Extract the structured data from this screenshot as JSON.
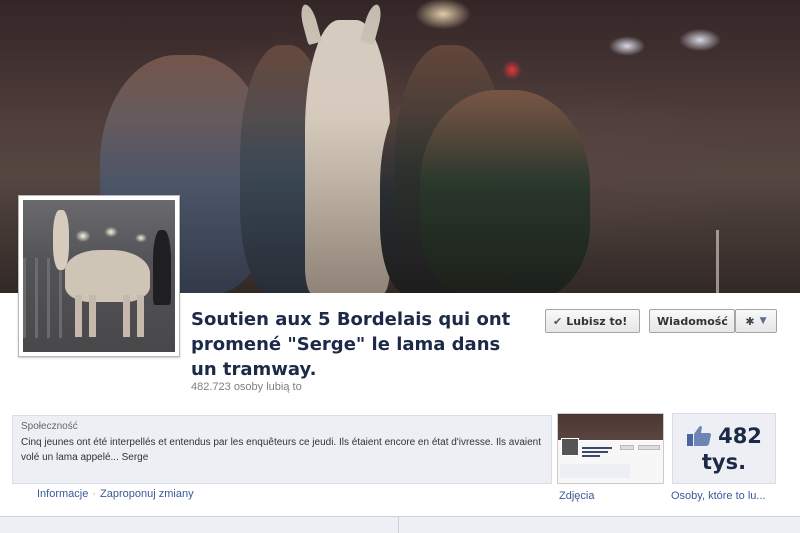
{
  "page": {
    "title": "Soutien aux 5 Bordelais qui ont promené \"Serge\" le lama dans un tramway.",
    "likes_line": "482.723 osoby lubią to"
  },
  "actions": {
    "like_label": "Lubisz to!",
    "message_label": "Wiadomość"
  },
  "about": {
    "category": "Społeczność",
    "description": "Cinq jeunes ont été interpellés et entendus par les enquêteurs ce jeudi. Ils étaient encore en état d'ivresse. Ils avaient volé un lama appelé... Serge"
  },
  "links": {
    "info": "Informacje",
    "separator": "·",
    "suggest": "Zaproponuj zmiany"
  },
  "tiles": {
    "photos_label": "Zdjęcia",
    "likes_number": "482",
    "likes_unit": "tys.",
    "likes_label": "Osoby, które to lu..."
  },
  "colors": {
    "title": "#1c2a47",
    "link": "#3b5998",
    "panel": "#edeff4"
  },
  "icons": [
    "check-icon",
    "gear-icon",
    "caret-down-icon",
    "thumbs-up-icon"
  ]
}
